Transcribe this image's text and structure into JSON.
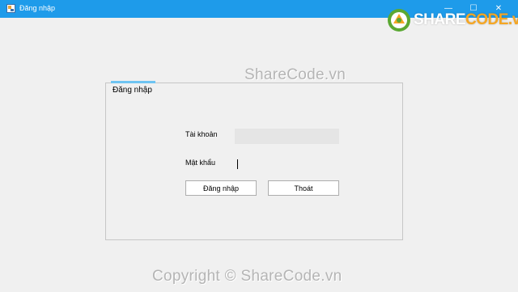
{
  "window": {
    "title": "Đăng nhập",
    "controls": {
      "minimize": "—",
      "maximize": "☐",
      "close": "✕"
    }
  },
  "logo": {
    "part1": "SHARE",
    "part2": "CODE.vn"
  },
  "watermarks": {
    "center": "ShareCode.vn",
    "bottom": "Copyright © ShareCode.vn"
  },
  "tab": {
    "label": "Đăng nhập"
  },
  "form": {
    "account_label": "Tài khoản",
    "account_value": "",
    "password_label": "Mật khẩu",
    "password_value": "",
    "login_button": "Đăng nhập",
    "exit_button": "Thoát"
  },
  "colors": {
    "titlebar": "#1e9bea",
    "background": "#f0f0f0",
    "tab_accent": "#6ec4f2",
    "logo_green": "#5aa832",
    "logo_orange": "#f5a623"
  }
}
